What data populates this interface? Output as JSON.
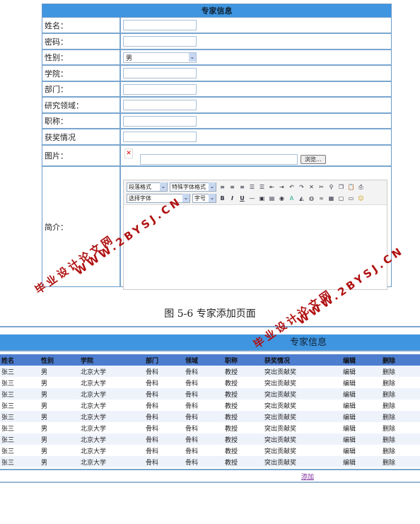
{
  "form": {
    "title": "专家信息",
    "fields": [
      {
        "label": "姓名：",
        "type": "text"
      },
      {
        "label": "密码：",
        "type": "text"
      },
      {
        "label": "性别：",
        "type": "select",
        "value": "男"
      },
      {
        "label": "学院：",
        "type": "text"
      },
      {
        "label": "部门：",
        "type": "text"
      },
      {
        "label": "研究领域：",
        "type": "text"
      },
      {
        "label": "职称：",
        "type": "text"
      },
      {
        "label": "获奖情况",
        "type": "text"
      }
    ],
    "image_label": "图片：",
    "browse": "浏览...",
    "intro_label": "简介：",
    "editor": {
      "paragraph": "段落格式",
      "special": "特殊字体格式",
      "font": "选择字体",
      "size": "字号",
      "bold": "B",
      "italic": "I",
      "underline": "U"
    }
  },
  "caption": "图 5-6 专家添加页面",
  "list": {
    "title": "专家信息",
    "columns": [
      "姓名",
      "性别",
      "学院",
      "部门",
      "领域",
      "职称",
      "获奖情况",
      "编辑",
      "删除"
    ],
    "rows": [
      [
        "张三",
        "男",
        "北京大学",
        "骨科",
        "骨科",
        "教授",
        "突出贡献奖",
        "编辑",
        "删除"
      ],
      [
        "张三",
        "男",
        "北京大学",
        "骨科",
        "骨科",
        "教授",
        "突出贡献奖",
        "编辑",
        "删除"
      ],
      [
        "张三",
        "男",
        "北京大学",
        "骨科",
        "骨科",
        "教授",
        "突出贡献奖",
        "编辑",
        "删除"
      ],
      [
        "张三",
        "男",
        "北京大学",
        "骨科",
        "骨科",
        "教授",
        "突出贡献奖",
        "编辑",
        "删除"
      ],
      [
        "张三",
        "男",
        "北京大学",
        "骨科",
        "骨科",
        "教授",
        "突出贡献奖",
        "编辑",
        "删除"
      ],
      [
        "张三",
        "男",
        "北京大学",
        "骨科",
        "骨科",
        "教授",
        "突出贡献奖",
        "编辑",
        "删除"
      ],
      [
        "张三",
        "男",
        "北京大学",
        "骨科",
        "骨科",
        "教授",
        "突出贡献奖",
        "编辑",
        "删除"
      ],
      [
        "张三",
        "男",
        "北京大学",
        "骨科",
        "骨科",
        "教授",
        "突出贡献奖",
        "编辑",
        "删除"
      ],
      [
        "张三",
        "男",
        "北京大学",
        "骨科",
        "骨科",
        "教授",
        "突出贡献奖",
        "编辑",
        "删除"
      ]
    ],
    "add": "添加"
  },
  "watermark": {
    "cn": "毕业设计论文网",
    "url": "WWW.2BYSJ.CN",
    "color": "#b01010"
  }
}
